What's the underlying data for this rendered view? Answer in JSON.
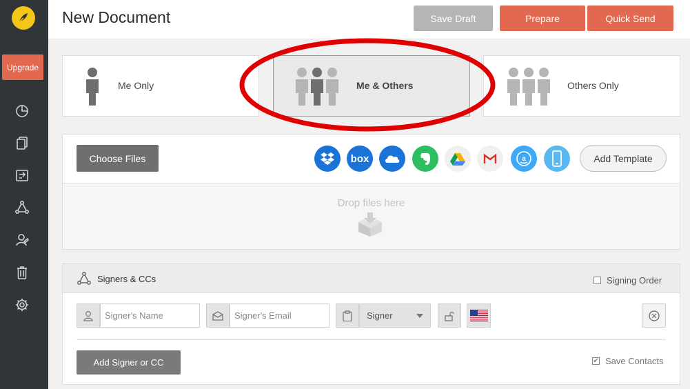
{
  "sidebar": {
    "logo_icon": "feather-logo-icon",
    "upgrade_label": "Upgrade",
    "items": [
      {
        "icon": "pie-chart-icon"
      },
      {
        "icon": "documents-icon"
      },
      {
        "icon": "templates-icon"
      },
      {
        "icon": "workflow-icon"
      },
      {
        "icon": "contacts-icon"
      },
      {
        "icon": "trash-icon"
      },
      {
        "icon": "settings-gear-icon"
      }
    ]
  },
  "header": {
    "title": "New Document",
    "save_draft_label": "Save Draft",
    "prepare_label": "Prepare",
    "quick_send_label": "Quick Send"
  },
  "recipient_options": [
    {
      "label": "Me Only",
      "selected": false
    },
    {
      "label": "Me & Others",
      "selected": true
    },
    {
      "label": "Others Only",
      "selected": false
    }
  ],
  "files": {
    "choose_files_label": "Choose Files",
    "sources": [
      {
        "name": "dropbox-icon",
        "color": "#1a73d6"
      },
      {
        "name": "box-icon",
        "color": "#1a73d6",
        "text": "box"
      },
      {
        "name": "onedrive-icon",
        "color": "#1a73d6"
      },
      {
        "name": "evernote-icon",
        "color": "#2dbe60"
      },
      {
        "name": "google-drive-icon",
        "color": "#f0f0f0"
      },
      {
        "name": "gmail-icon",
        "color": "#f0f0f0"
      },
      {
        "name": "amazon-drive-icon",
        "color": "#3fa9f5"
      },
      {
        "name": "device-icon",
        "color": "#5ab8f0"
      }
    ],
    "add_template_label": "Add Template",
    "drop_text": "Drop files here"
  },
  "signers": {
    "title": "Signers & CCs",
    "signing_order_label": "Signing Order",
    "signing_order_checked": false,
    "name_placeholder": "Signer's Name",
    "email_placeholder": "Signer's Email",
    "role_value": "Signer",
    "add_signer_label": "Add Signer or CC",
    "save_contacts_label": "Save Contacts",
    "save_contacts_checked": true
  },
  "colors": {
    "accent": "#e2694f",
    "sidebar": "#2f3539",
    "annotation": "#e00000"
  }
}
